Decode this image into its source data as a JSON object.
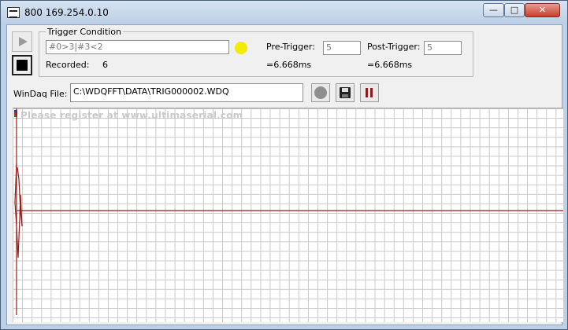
{
  "window": {
    "title": "800 169.254.0.10",
    "min_glyph": "—",
    "max_glyph": "□",
    "close_glyph": "✕"
  },
  "trigger": {
    "group_label": "Trigger Condition",
    "condition_value": "#0>3|#3<2",
    "status_color": "#f2ea08",
    "recorded_label": "Recorded:",
    "recorded_value": "6",
    "pre_trigger_label": "Pre-Trigger:",
    "pre_trigger_value": "5",
    "pre_trigger_time": "=6.668ms",
    "post_trigger_label": "Post-Trigger:",
    "post_trigger_value": "5",
    "post_trigger_time": "=6.668ms"
  },
  "file": {
    "label": "WinDaq File:",
    "path": "C:\\WDQFFT\\DATA\\TRIG000002.WDQ"
  },
  "toolbar": {
    "play_icon": "play-icon",
    "stop_icon": "stop-icon",
    "record_icon": "record-icon",
    "save_icon": "floppy-disk-icon",
    "pause_icon": "pause-icon"
  },
  "chart": {
    "watermark": "Please register at www.ultimaserial.com",
    "trace_color": "#9a1a1a",
    "marker_colors": [
      "#1f3fbf",
      "#c01f1f",
      "#2a7a2a"
    ]
  }
}
